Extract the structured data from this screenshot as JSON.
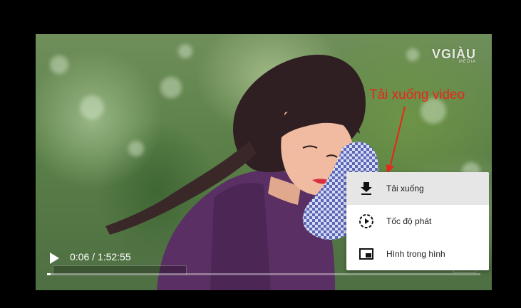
{
  "watermark": {
    "brand": "VGIÀU",
    "sub": "MEDIA"
  },
  "annotation": {
    "text": "Tải xuống video",
    "color": "#e8261a"
  },
  "player": {
    "time_display": "0:06 / 1:52:55",
    "progress_fraction": 0.0009
  },
  "menu": {
    "items": [
      {
        "label": "Tải xuống",
        "icon": "download-icon",
        "active": true
      },
      {
        "label": "Tốc độ phát",
        "icon": "playback-speed-icon",
        "active": false
      },
      {
        "label": "Hình trong hình",
        "icon": "picture-in-picture-icon",
        "active": false
      }
    ]
  }
}
